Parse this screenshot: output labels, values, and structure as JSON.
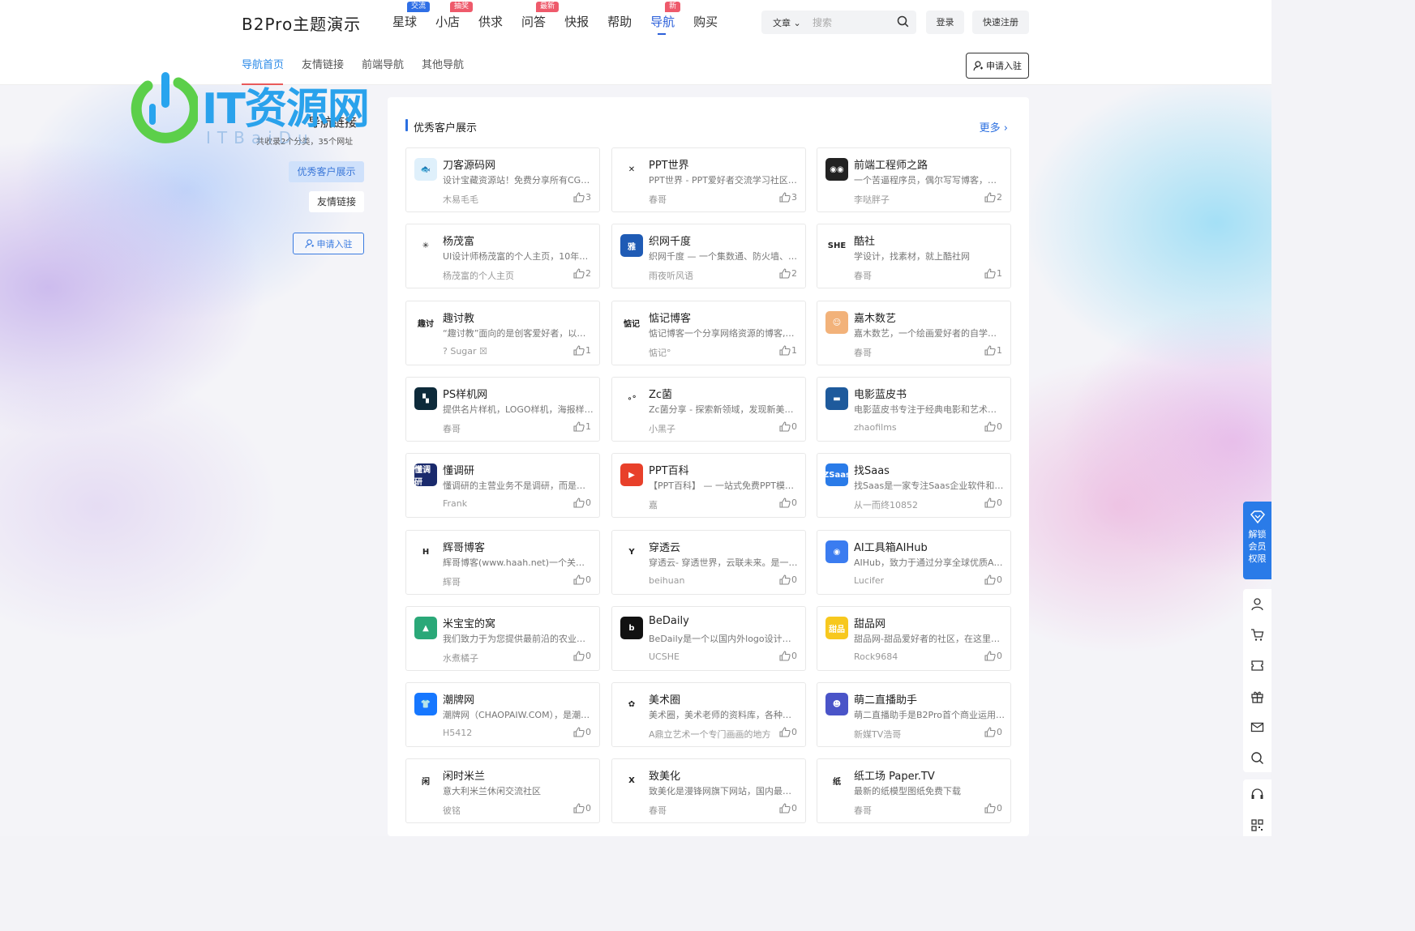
{
  "header": {
    "logo": "B2Pro主题演示",
    "nav": [
      {
        "label": "星球",
        "badge": "交流",
        "badge_color": "#2f6fe6"
      },
      {
        "label": "小店",
        "badge": "抽奖",
        "badge_color": "#ee5a6b"
      },
      {
        "label": "供求",
        "badge": "",
        "badge_color": ""
      },
      {
        "label": "问答",
        "badge": "最新",
        "badge_color": "#ee5a6b"
      },
      {
        "label": "快报",
        "badge": "",
        "badge_color": ""
      },
      {
        "label": "帮助",
        "badge": "",
        "badge_color": ""
      },
      {
        "label": "导航",
        "badge": "新",
        "badge_color": "#ee5a6b",
        "active": true
      },
      {
        "label": "购买",
        "badge": "",
        "badge_color": ""
      }
    ],
    "search": {
      "category": "文章",
      "placeholder": "搜索"
    },
    "login": "登录",
    "register": "快速注册"
  },
  "subnav": {
    "items": [
      "导航首页",
      "友情链接",
      "前端导航",
      "其他导航"
    ],
    "apply": "申请入驻"
  },
  "watermark": {
    "text": "IT资源网",
    "sub": "ITBaiDu"
  },
  "sidebar": {
    "title": "导航链接",
    "count": "共收录2个分类，35个网址",
    "items": [
      "优秀客户展示",
      "友情链接"
    ],
    "apply": "申请入驻"
  },
  "section": {
    "title": "优秀客户展示",
    "more": "更多"
  },
  "cards": [
    {
      "name": "刀客源码网",
      "desc": "设计宝藏资源站！免费分享所有CG…",
      "author": "木易毛毛",
      "likes": "3",
      "icon_text": "🐟",
      "icon_bg": "#dff0fb"
    },
    {
      "name": "PPT世界",
      "desc": "PPT世界 - PPT爱好者交流学习社区…",
      "author": "春哥",
      "likes": "3",
      "icon_text": "✕",
      "icon_bg": "#ffffff"
    },
    {
      "name": "前端工程师之路",
      "desc": "一个苦逼程序员，偶尔写写博客，改…",
      "author": "李哒胖子",
      "likes": "2",
      "icon_text": "◉◉",
      "icon_bg": "#222222"
    },
    {
      "name": "杨茂富",
      "desc": "UI设计师杨茂富的个人主页，10年…",
      "author": "杨茂富的个人主页",
      "likes": "2",
      "icon_text": "✳",
      "icon_bg": "#ffffff"
    },
    {
      "name": "织网千度",
      "desc": "织网千度 — 一个集数通、防火墙、无…",
      "author": "雨夜听风语",
      "likes": "2",
      "icon_text": "雅",
      "icon_bg": "#1f5bb5"
    },
    {
      "name": "酷社",
      "desc": "学设计，找素材，就上酷社网",
      "author": "春哥",
      "likes": "1",
      "icon_text": "SHE",
      "icon_bg": "#ffffff"
    },
    {
      "name": "趣讨教",
      "desc": "“趣讨教”面向的是创客爱好者，以…",
      "author": "? Sugar ☒",
      "likes": "1",
      "icon_text": "趣讨",
      "icon_bg": "#ffffff"
    },
    {
      "name": "惦记博客",
      "desc": "惦记博客一个分享网络资源的博客,…",
      "author": "惦记°",
      "likes": "1",
      "icon_text": "惦记",
      "icon_bg": "#ffffff"
    },
    {
      "name": "嘉木数艺",
      "desc": "嘉木数艺，一个绘画爱好者的自学平…",
      "author": "春哥",
      "likes": "1",
      "icon_text": "☺",
      "icon_bg": "#f2b27a"
    },
    {
      "name": "PS样机网",
      "desc": "提供名片样机，LOGO样机，海报样…",
      "author": "春哥",
      "likes": "1",
      "icon_text": "▚",
      "icon_bg": "#0d2a3a"
    },
    {
      "name": "Zc菌",
      "desc": "Zc菌分享 - 探索新领域，发现新美好…",
      "author": "小黑子",
      "likes": "0",
      "icon_text": "∘°",
      "icon_bg": "#ffffff"
    },
    {
      "name": "电影蓝皮书",
      "desc": "电影蓝皮书专注于经典电影和艺术电…",
      "author": "zhaofilms",
      "likes": "0",
      "icon_text": "▬",
      "icon_bg": "#1e5a9c"
    },
    {
      "name": "懂调研",
      "desc": "懂调研的主营业务不是调研，而是测…",
      "author": "Frank",
      "likes": "0",
      "icon_text": "懂调研",
      "icon_bg": "#1a2a6c"
    },
    {
      "name": "PPT百科",
      "desc": "【PPT百科】 — 一站式免费PPT模板…",
      "author": "嘉",
      "likes": "0",
      "icon_text": "▶",
      "icon_bg": "#e8402a"
    },
    {
      "name": "找Saas",
      "desc": "找Saas是一家专注Saas企业软件和…",
      "author": "从一而终10852",
      "likes": "0",
      "icon_text": "ZSaas",
      "icon_bg": "#2a7be8"
    },
    {
      "name": "辉哥博客",
      "desc": "辉哥博客(www.haah.net)一个关注…",
      "author": "辉哥",
      "likes": "0",
      "icon_text": "H",
      "icon_bg": "#ffffff"
    },
    {
      "name": "穿透云",
      "desc": "穿透云- 穿透世界，云联未来。是一…",
      "author": "beihuan",
      "likes": "0",
      "icon_text": "Y",
      "icon_bg": "#ffffff"
    },
    {
      "name": "AI工具箱AIHub",
      "desc": "AIHub，致力于通过分享全球优质AI…",
      "author": "Lucifer",
      "likes": "0",
      "icon_text": "◉",
      "icon_bg": "#3b7cf0"
    },
    {
      "name": "米宝宝的窝",
      "desc": "我们致力于为您提供最前沿的农业农…",
      "author": "水煮橘子",
      "likes": "0",
      "icon_text": "▲",
      "icon_bg": "#2aa878"
    },
    {
      "name": "BeDaily",
      "desc": "BeDaily是一个以国内外logo设计分…",
      "author": "UCSHE",
      "likes": "0",
      "icon_text": "b",
      "icon_bg": "#111111"
    },
    {
      "name": "甜品网",
      "desc": "甜品网-甜品爱好者的社区，在这里…",
      "author": "Rock9684",
      "likes": "0",
      "icon_text": "甜品",
      "icon_bg": "#f7c81e"
    },
    {
      "name": "潮牌网",
      "desc": "潮牌网（CHAOPAIW.COM），是潮…",
      "author": "H5412",
      "likes": "0",
      "icon_text": "👕",
      "icon_bg": "#1677ff"
    },
    {
      "name": "美术圈",
      "desc": "美术圈，美术老师的资料库，各种美…",
      "author": "A鼎立艺术一个专门画画的地方",
      "likes": "0",
      "icon_text": "✿",
      "icon_bg": "#ffffff"
    },
    {
      "name": "萌二直播助手",
      "desc": "萌二直播助手是B2Pro首个商业运用…",
      "author": "新媒TV浩哥",
      "likes": "0",
      "icon_text": "☻",
      "icon_bg": "#4a54c8"
    },
    {
      "name": "闲时米兰",
      "desc": "意大利米兰休闲交流社区",
      "author": "彼铭",
      "likes": "0",
      "icon_text": "闲",
      "icon_bg": "#ffffff"
    },
    {
      "name": "致美化",
      "desc": "致美化是漫锋网旗下网站，国内最专…",
      "author": "春哥",
      "likes": "0",
      "icon_text": "X",
      "icon_bg": "#ffffff"
    },
    {
      "name": "纸工场 Paper.TV",
      "desc": "最新的纸模型图纸免费下载",
      "author": "春哥",
      "likes": "0",
      "icon_text": "纸",
      "icon_bg": "#ffffff"
    }
  ],
  "toolbar": {
    "unlock": "解锁会员权限"
  }
}
